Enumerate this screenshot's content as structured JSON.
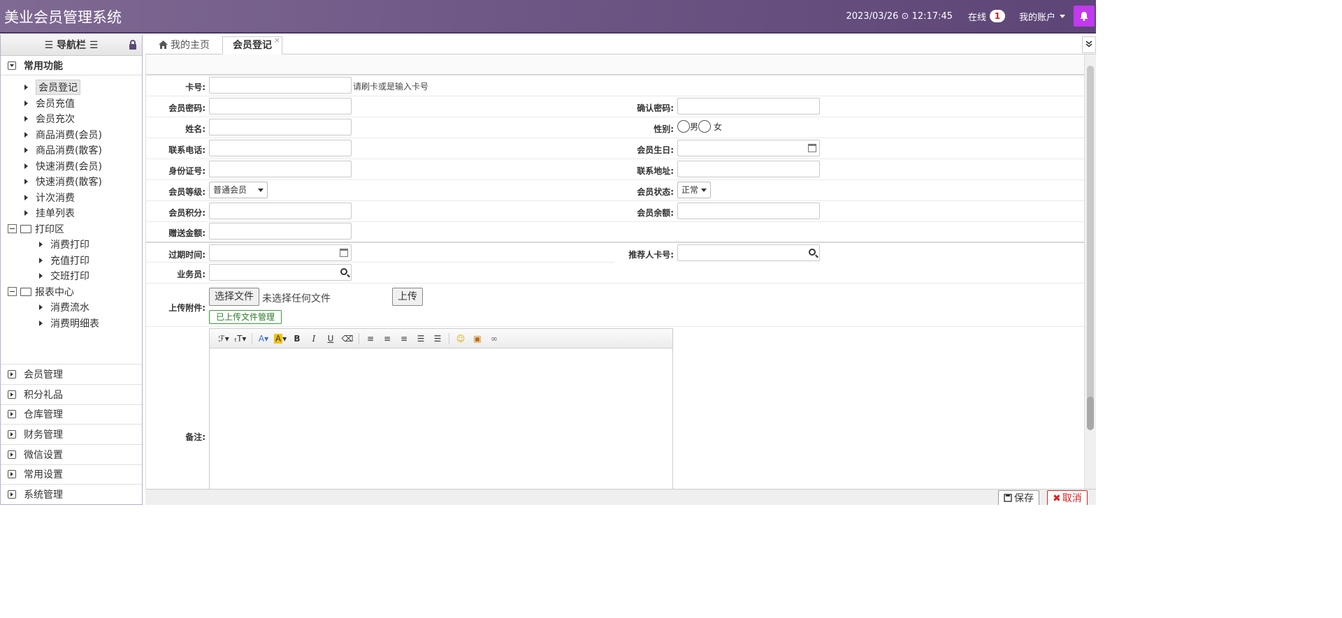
{
  "app": {
    "title": "美业会员管理系统"
  },
  "topbar": {
    "datetime": "2023/03/26 ⊙ 12:17:45",
    "online_label": "在线",
    "online_count": "1",
    "account_label": "我的账户"
  },
  "sidebar": {
    "header": "☰ 导航栏 ☰",
    "main_section": "常用功能",
    "items": [
      "会员登记",
      "会员充值",
      "会员充次",
      "商品消费(会员)",
      "商品消费(散客)",
      "快速消费(会员)",
      "快速消费(散客)",
      "计次消费",
      "挂单列表"
    ],
    "print_folder": "打印区",
    "print_items": [
      "消费打印",
      "充值打印",
      "交班打印"
    ],
    "report_folder": "报表中心",
    "report_items": [
      "消费流水",
      "消费明细表"
    ],
    "bottom_sections": [
      "会员管理",
      "积分礼品",
      "仓库管理",
      "财务管理",
      "微信设置",
      "常用设置",
      "系统管理"
    ]
  },
  "tabs": {
    "home": "我的主页",
    "active": "会员登记",
    "close": "×"
  },
  "form": {
    "card_no": "卡号:",
    "card_hint": "请刷卡或是输入卡号",
    "password": "会员密码:",
    "confirm_password": "确认密码:",
    "name": "姓名:",
    "gender": "性别:",
    "male": "男",
    "female": "女",
    "phone": "联系电话:",
    "birthday": "会员生日:",
    "id_no": "身份证号:",
    "address": "联系地址:",
    "level": "会员等级:",
    "level_value": "普通会员",
    "status": "会员状态:",
    "status_value": "正常",
    "points": "会员积分:",
    "balance": "会员余额:",
    "gift_amount": "赠送金额:",
    "expire": "过期时间:",
    "referrer": "推荐人卡号:",
    "staff": "业务员:",
    "attachment": "上传附件:",
    "choose_file": "选择文件",
    "no_file": "未选择任何文件",
    "upload": "上传",
    "uploaded_mgmt": "已上传文件管理",
    "remark": "备注:"
  },
  "footer": {
    "save": "保存",
    "cancel": "取消"
  }
}
